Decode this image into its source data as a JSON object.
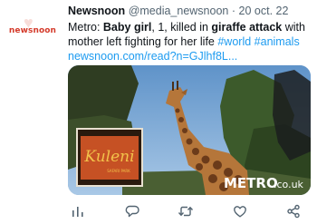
{
  "tweet": {
    "author_name": "Newsnoon",
    "author_handle": "@media_newsnoon",
    "separator": "·",
    "date": "20 oct. 22",
    "text_prefix": "Metro: ",
    "text_bold1": "Baby girl",
    "text_mid1": ", 1, killed in ",
    "text_bold2": "giraffe attack",
    "text_mid2": " with mother left fighting for her life ",
    "hashtag1": "#world",
    "hashtag2": "#animals",
    "link": "newsnoon.com/read?n=GJlhf8L..."
  },
  "avatar": {
    "brand": "newsnoon"
  },
  "media": {
    "sign_text": "Kuleni",
    "sign_subtext": "SAFARI PARK",
    "watermark": "METRO",
    "watermark_suffix": ".co.uk"
  },
  "actions": [
    {
      "name": "analytics-icon"
    },
    {
      "name": "reply-icon"
    },
    {
      "name": "retweet-icon"
    },
    {
      "name": "like-icon"
    },
    {
      "name": "share-icon"
    }
  ],
  "colors": {
    "link": "#1d9bf0",
    "icon": "#536471",
    "brand": "#d43a2a"
  }
}
